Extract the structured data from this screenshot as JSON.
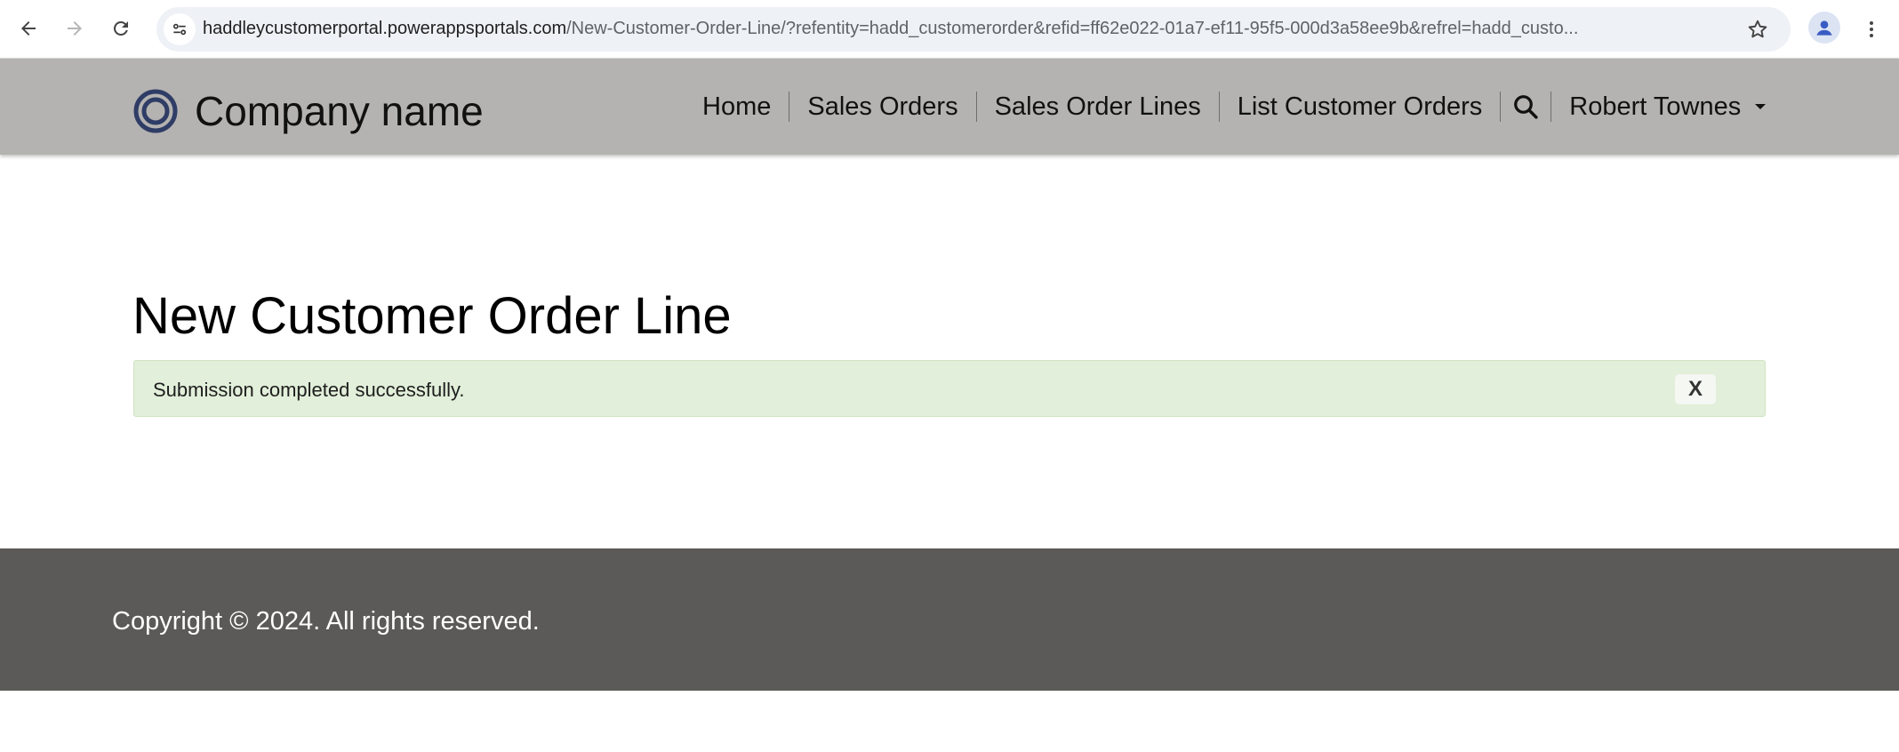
{
  "browser": {
    "url_host": "haddleycustomerportal.powerappsportals.com",
    "url_path": "/New-Customer-Order-Line/?refentity=hadd_customerorder&refid=ff62e022-01a7-ef11-95f5-000d3a58ee9b&refrel=hadd_custo..."
  },
  "header": {
    "company_name": "Company name",
    "nav": {
      "home": "Home",
      "sales_orders": "Sales Orders",
      "sales_order_lines": "Sales Order Lines",
      "list_customer_orders": "List Customer Orders"
    },
    "user_name": "Robert Townes"
  },
  "main": {
    "title": "New Customer Order Line",
    "alert": {
      "message": "Submission completed successfully.",
      "close_label": "X"
    }
  },
  "footer": {
    "copyright": "Copyright © 2024. All rights reserved."
  },
  "colors": {
    "header_bg": "#b4b3b1",
    "footer_bg": "#5b5a58",
    "alert_bg": "#e2efda",
    "logo": "#2f3d66"
  }
}
